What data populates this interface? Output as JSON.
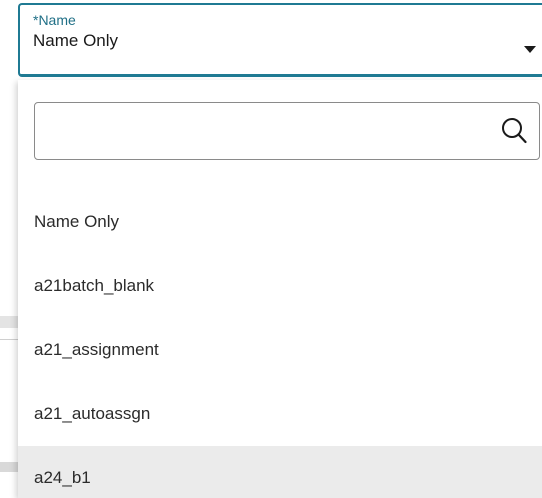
{
  "select": {
    "label": "*Name",
    "value": "Name Only"
  },
  "search": {
    "value": "",
    "placeholder": ""
  },
  "options": [
    {
      "label": "Name Only"
    },
    {
      "label": "a21batch_blank"
    },
    {
      "label": "a21_assignment"
    },
    {
      "label": "a21_autoassgn"
    },
    {
      "label": "a24_b1",
      "highlighted": true
    }
  ],
  "icons": {
    "caret": "caret-down-icon",
    "search": "search-icon"
  },
  "colors": {
    "accent": "#1f7a93",
    "label": "#1f6f86",
    "highlight": "#ebebeb"
  }
}
